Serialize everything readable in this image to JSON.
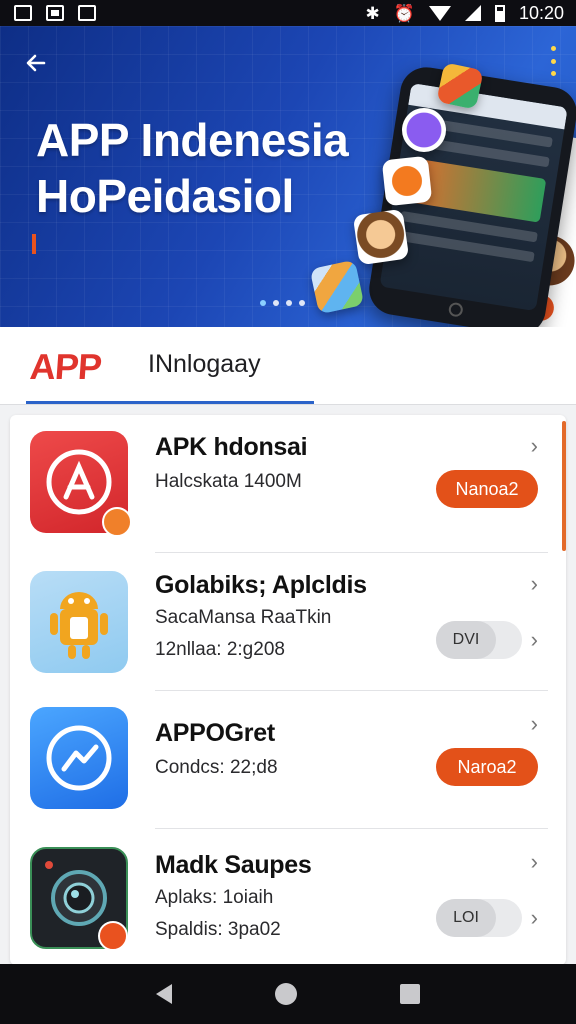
{
  "status_bar": {
    "time": "10:20"
  },
  "hero": {
    "title_line1": "APP Indenesia",
    "title_line2": "HoPeidasiol",
    "carousel_pages": 4,
    "carousel_active": 1
  },
  "tabs": {
    "logo_text": "APP",
    "label": "INnlogaay"
  },
  "apps": [
    {
      "name": "APK hdonsai",
      "line1": "Halcskata 1400M",
      "line2": "",
      "action": "Nanoa2",
      "action_type": "button",
      "icon": "app-store-icon"
    },
    {
      "name": "Golabiks; Aplcldis",
      "line1": "SacaMansa RaaTkin",
      "line2": "12nllaa: 2:g208",
      "action": "DVI",
      "action_type": "toggle",
      "icon": "android-robot-icon"
    },
    {
      "name": "APPOGret",
      "line1": "Condcs: 22;d8",
      "line2": "",
      "action": "Naroa2",
      "action_type": "button",
      "icon": "messenger-icon"
    },
    {
      "name": "Madk Saupes",
      "line1": "Aplaks: 1oiaih",
      "line2": "Spaldis: 3pa02",
      "action": "LOI",
      "action_type": "toggle",
      "icon": "camera-lens-icon"
    }
  ],
  "colors": {
    "accent_orange": "#e35119",
    "hero_blue": "#1c46b4",
    "tab_indicator": "#2b63c9",
    "logo_red": "#e0342d"
  }
}
